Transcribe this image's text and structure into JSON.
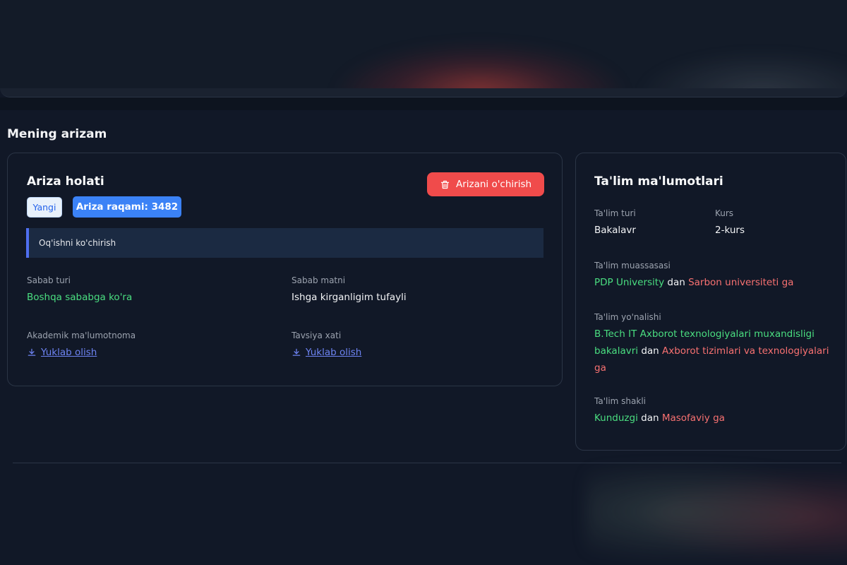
{
  "page": {
    "section_title": "Mening arizam"
  },
  "application": {
    "heading": "Ariza holati",
    "delete_label": "Arizani o'chirish",
    "status_badge": "Yangi",
    "number_badge": "Ariza raqami: 3482",
    "type_text": "Oq'ishni ko'chirish",
    "fields": {
      "reason_type_label": "Sabab turi",
      "reason_type_value": "Boshqa sababga ko'ra",
      "reason_text_label": "Sabab matni",
      "reason_text_value": "Ishga kirganligim tufayli",
      "academic_label": "Akademik ma'lumotnoma",
      "academic_link": "Yuklab olish",
      "recommendation_label": "Tavsiya xati",
      "recommendation_link": "Yuklab olish"
    }
  },
  "education": {
    "heading": "Ta'lim ma'lumotlari",
    "type_label": "Ta'lim turi",
    "type_value": "Bakalavr",
    "course_label": "Kurs",
    "course_value": "2-kurs",
    "institution_label": "Ta'lim muassasasi",
    "institution_from": "PDP University",
    "institution_join": "dan",
    "institution_to": "Sarbon universiteti ga",
    "direction_label": "Ta'lim yo'nalishi",
    "direction_from": "B.Tech IT Axborot texnologiyalari muxandisligi bakalavri",
    "direction_join": "dan",
    "direction_to": "Axborot tizimlari va texnologiyalari ga",
    "form_label": "Ta'lim shakli",
    "form_from": "Kunduzgi",
    "form_join": "dan",
    "form_to": "Masofaviy ga"
  },
  "colors": {
    "accent_red": "#f04b4b",
    "accent_blue": "#3b82f6",
    "success_green": "#4ade80",
    "link_blue": "#6d83f2"
  }
}
